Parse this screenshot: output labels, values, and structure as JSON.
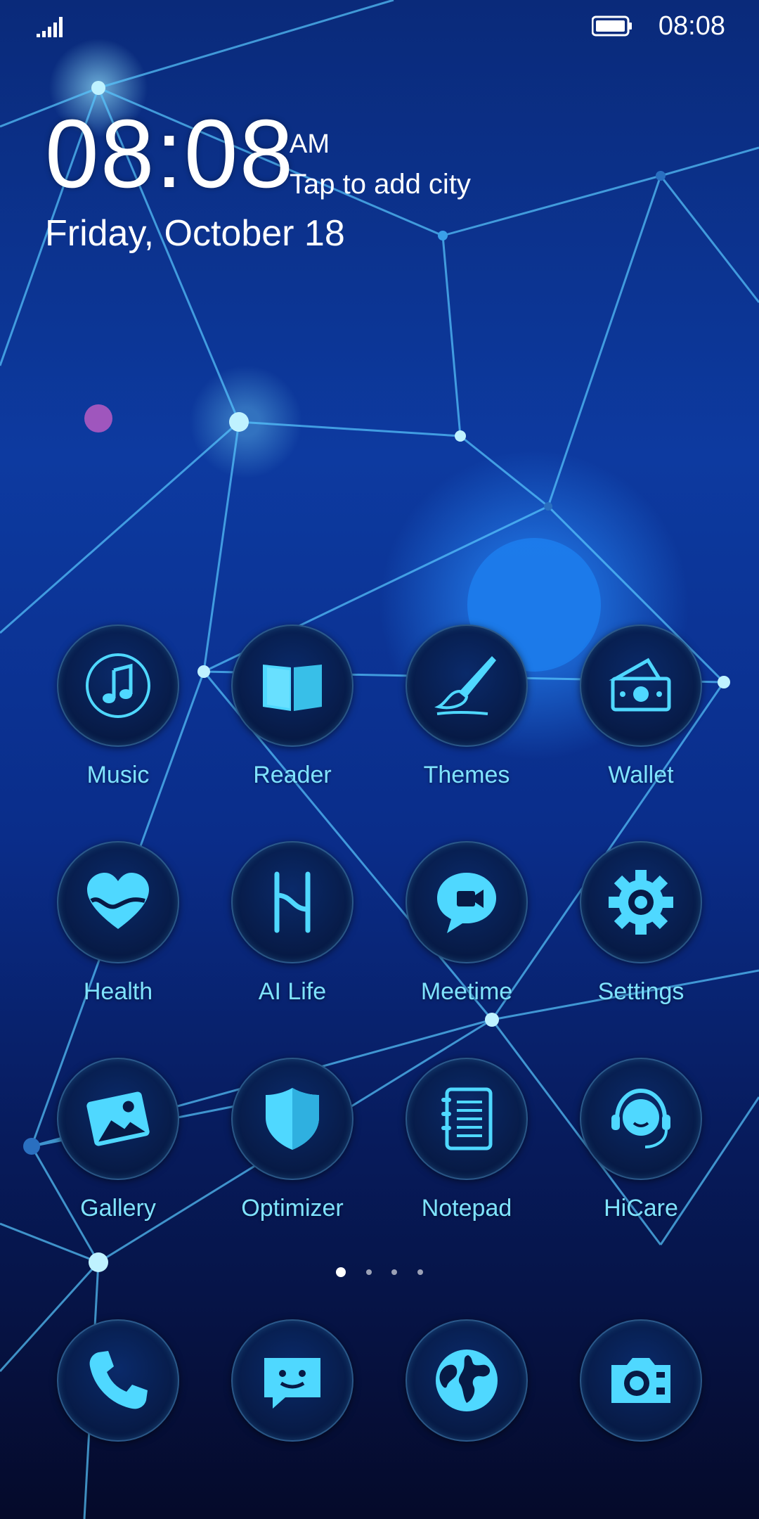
{
  "status_bar": {
    "time": "08:08",
    "icons": [
      "signal-icon",
      "battery-icon"
    ]
  },
  "lock_clock": {
    "time": "08:08",
    "ampm": "AM",
    "city_prompt": "Tap to add city",
    "date": "Friday, October 18"
  },
  "apps": [
    {
      "label": "Music",
      "icon": "music-icon"
    },
    {
      "label": "Reader",
      "icon": "book-icon"
    },
    {
      "label": "Themes",
      "icon": "brush-icon"
    },
    {
      "label": "Wallet",
      "icon": "wallet-icon"
    },
    {
      "label": "Health",
      "icon": "heart-icon"
    },
    {
      "label": "AI Life",
      "icon": "ai-life-icon"
    },
    {
      "label": "Meetime",
      "icon": "video-chat-icon"
    },
    {
      "label": "Settings",
      "icon": "gear-icon"
    },
    {
      "label": "Gallery",
      "icon": "image-icon"
    },
    {
      "label": "Optimizer",
      "icon": "shield-icon"
    },
    {
      "label": "Notepad",
      "icon": "notepad-icon"
    },
    {
      "label": "HiCare",
      "icon": "headset-icon"
    }
  ],
  "dock": [
    {
      "icon": "phone-icon"
    },
    {
      "icon": "message-icon"
    },
    {
      "icon": "globe-icon"
    },
    {
      "icon": "camera-icon"
    }
  ],
  "page_indicator": {
    "pages": 4,
    "current": 1
  },
  "colors": {
    "icon_accent": "#4fd8ff",
    "label": "#7fe3ff"
  }
}
